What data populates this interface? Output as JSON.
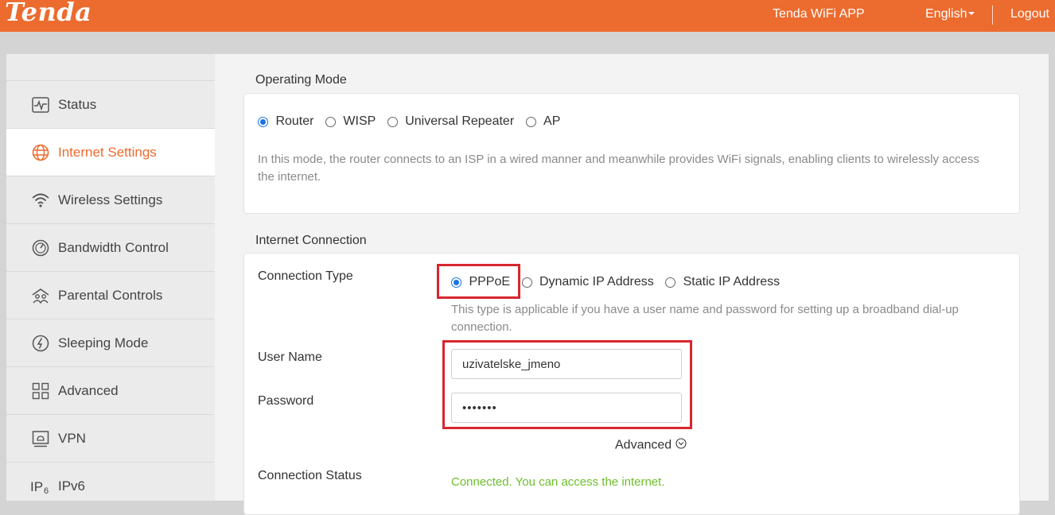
{
  "header": {
    "brand": "Tenda",
    "app_link": "Tenda WiFi APP",
    "language": "English",
    "logout": "Logout"
  },
  "sidebar": {
    "items": [
      {
        "label": "Status",
        "icon": "status-icon"
      },
      {
        "label": "Internet Settings",
        "icon": "globe-icon",
        "active": true
      },
      {
        "label": "Wireless Settings",
        "icon": "wifi-icon"
      },
      {
        "label": "Bandwidth Control",
        "icon": "speedometer-icon"
      },
      {
        "label": "Parental Controls",
        "icon": "parental-icon"
      },
      {
        "label": "Sleeping Mode",
        "icon": "sleep-icon"
      },
      {
        "label": "Advanced",
        "icon": "grid-icon"
      },
      {
        "label": "VPN",
        "icon": "vpn-icon"
      },
      {
        "label": "IPv6",
        "icon": "ipv6-icon"
      }
    ]
  },
  "operating_mode": {
    "title": "Operating Mode",
    "options": [
      "Router",
      "WISP",
      "Universal Repeater",
      "AP"
    ],
    "selected": "Router",
    "description": "In this mode, the router connects to an ISP in a wired manner and meanwhile provides WiFi signals, enabling clients to wirelessly access the internet."
  },
  "internet_connection": {
    "title": "Internet Connection",
    "connection_type_label": "Connection Type",
    "options": [
      "PPPoE",
      "Dynamic IP Address",
      "Static IP Address"
    ],
    "selected": "PPPoE",
    "type_hint": "This type is applicable if you have a user name and password for setting up a broadband dial-up connection.",
    "username_label": "User Name",
    "username_value": "uzivatelske_jmeno",
    "password_label": "Password",
    "password_value": "•••••••",
    "advanced_label": "Advanced",
    "status_label": "Connection Status",
    "status_text": "Connected. You can access the internet."
  },
  "colors": {
    "brand": "#ec6b2f",
    "accent_blue": "#1a73e8",
    "success": "#6cbf2a",
    "highlight": "#d8262f"
  }
}
